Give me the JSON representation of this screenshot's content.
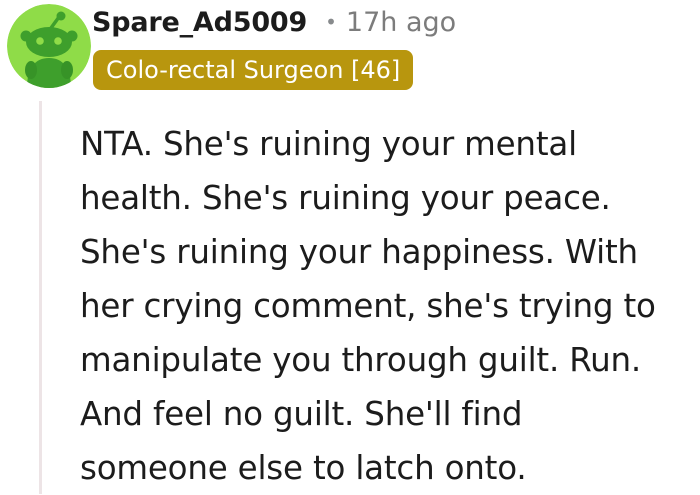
{
  "comment": {
    "author": "Spare_Ad5009",
    "separator": "•",
    "time_ago": "17h ago",
    "flair": "Colo-rectal Surgeon [46]",
    "body_lines": [
      "NTA. She's ruining your mental",
      "health. She's ruining your peace.",
      "She's ruining your happiness. With",
      "her crying comment, she's trying to",
      "manipulate you through guilt. Run.",
      "And feel no guilt. She'll find",
      "someone else to latch onto."
    ]
  },
  "colors": {
    "avatar_bg": "#8fdc48",
    "avatar_figure": "#3e9f2c",
    "flair_bg": "#b8960e",
    "flair_text": "#ffffff",
    "thread_line": "#ede4e6",
    "text": "#1c1c1c",
    "muted": "#7c7c7c"
  },
  "icons": {
    "avatar": "reddit-snoo-avatar-icon"
  }
}
